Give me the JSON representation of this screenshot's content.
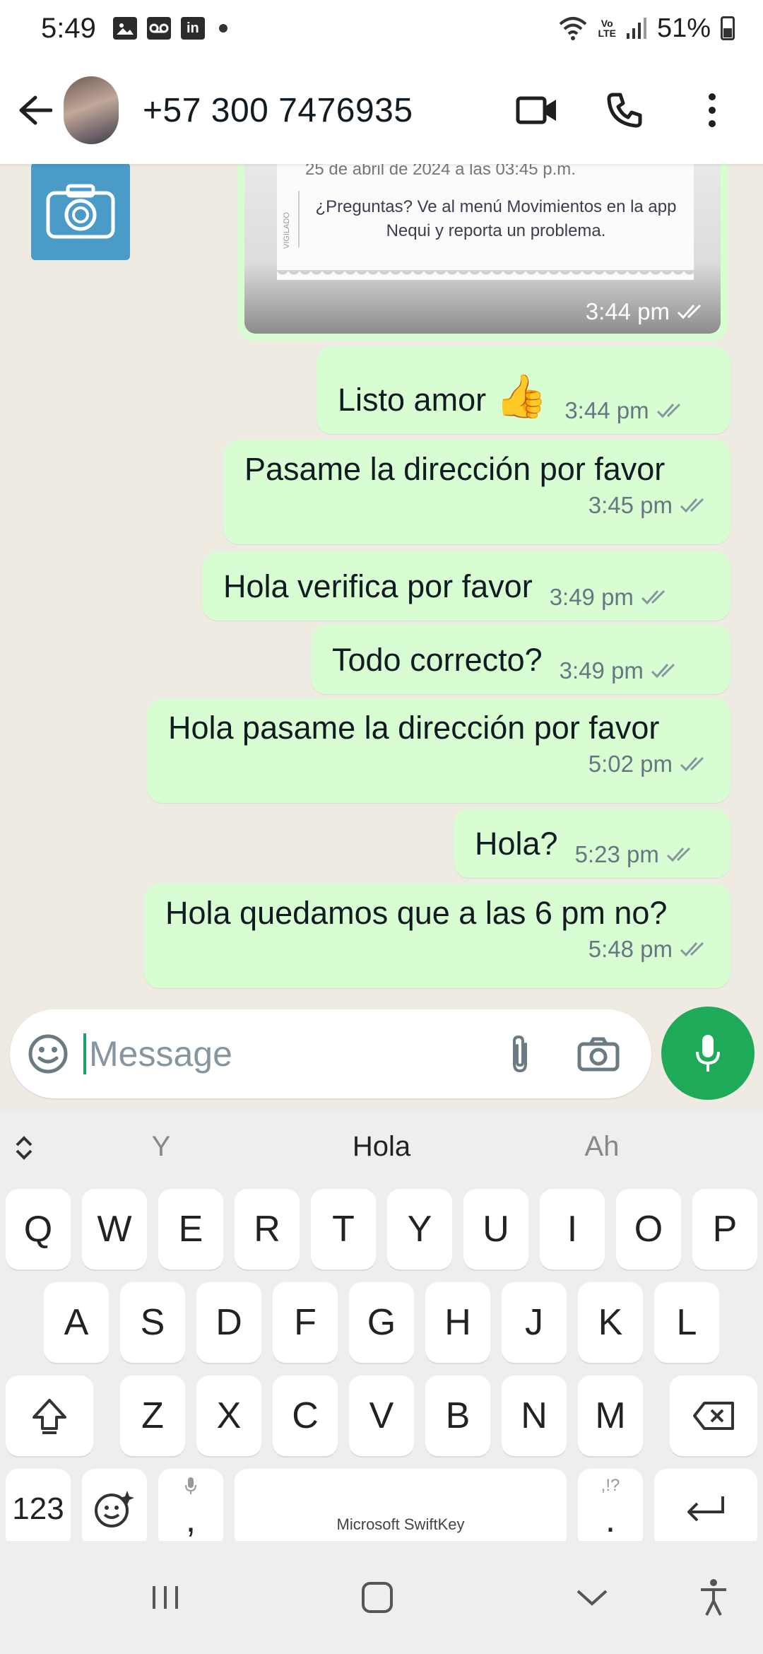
{
  "status_bar": {
    "time": "5:49",
    "battery": "51%",
    "notifications": [
      "gallery-icon",
      "voicemail-icon",
      "linkedin-icon"
    ],
    "volte_label_1": "Vo",
    "volte_label_2": "LTE"
  },
  "header": {
    "contact": "+57 300 7476935",
    "actions": [
      "video-call-icon",
      "phone-icon",
      "more-options-icon"
    ]
  },
  "chat": {
    "image_message": {
      "receipt_top": "25 de abril de 2024 a las 03:45 p.m.",
      "receipt_text": "¿Preguntas? Ve al menú Movimientos en la app Nequi y reporta un problema.",
      "receipt_stamp": "VIGILADO",
      "time": "3:44 pm"
    },
    "messages": [
      {
        "text": "Listo amor",
        "time": "3:44 pm",
        "emoji": "👍"
      },
      {
        "text": "Pasame la dirección por favor",
        "time": "3:45 pm"
      },
      {
        "text": "Hola verifica por favor",
        "time": "3:49 pm"
      },
      {
        "text": "Todo correcto?",
        "time": "3:49 pm"
      },
      {
        "text": "Hola pasame la dirección por favor",
        "time": "5:02 pm"
      },
      {
        "text": "Hola?",
        "time": "5:23 pm"
      },
      {
        "text": "Hola quedamos que a las 6 pm no?",
        "time": "5:48 pm"
      }
    ]
  },
  "input": {
    "placeholder": "Message"
  },
  "keyboard": {
    "suggestions": [
      "Y",
      "Hola",
      "Ah"
    ],
    "row1": [
      "Q",
      "W",
      "E",
      "R",
      "T",
      "Y",
      "U",
      "I",
      "O",
      "P"
    ],
    "row2": [
      "A",
      "S",
      "D",
      "F",
      "G",
      "H",
      "J",
      "K",
      "L"
    ],
    "row3": [
      "Z",
      "X",
      "C",
      "V",
      "B",
      "N",
      "M"
    ],
    "numbers_key": "123",
    "comma_key": ",",
    "period_key": ".",
    "period_sub": ",!?",
    "space_label": "Microsoft SwiftKey"
  },
  "colors": {
    "bubble_outgoing": "#d9fdd3",
    "accent_green": "#1faa59",
    "chat_background": "#efeae2",
    "tick_grey": "#8696a0"
  }
}
